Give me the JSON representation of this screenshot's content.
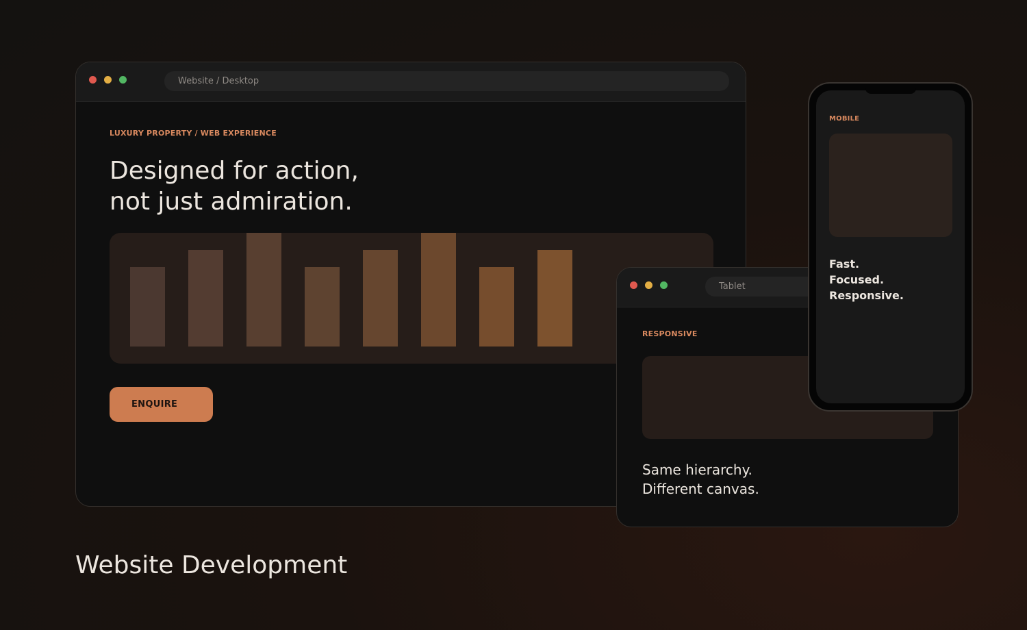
{
  "desktop": {
    "address": "Website / Desktop",
    "eyebrow": "LUXURY PROPERTY / WEB EXPERIENCE",
    "headline": [
      "Designed for action,",
      "not just admiration."
    ],
    "chart_data": {
      "type": "bar",
      "values": [
        116,
        141,
        166,
        116,
        141,
        166,
        116,
        141
      ],
      "colors": [
        "#4b3830",
        "#533c31",
        "#583f30",
        "#5e4330",
        "#66462f",
        "#6c482d",
        "#764d2d",
        "#7d522e"
      ]
    },
    "button_label": "ENQUIRE"
  },
  "tablet": {
    "address": "Tablet",
    "eyebrow": "RESPONSIVE",
    "copy": [
      "Same hierarchy.",
      "Different canvas."
    ]
  },
  "phone": {
    "eyebrow": "MOBILE",
    "copy": [
      "Fast.",
      "Focused.",
      "Responsive."
    ]
  },
  "caption": "Website Development",
  "colors": {
    "accent": "#cd7c50",
    "eyebrow": "#d9895f",
    "window_dot_red": "#e0594f",
    "window_dot_yellow": "#e3ae44",
    "window_dot_green": "#52b763"
  }
}
